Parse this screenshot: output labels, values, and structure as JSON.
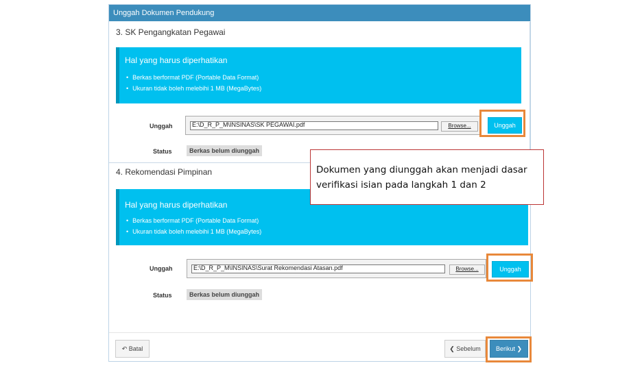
{
  "panel": {
    "title": "Unggah Dokumen Pendukung"
  },
  "sections": [
    {
      "title": "3. SK Pengangkatan Pegawai",
      "notice_title": "Hal yang harus diperhatikan",
      "notice_items": [
        "Berkas berformat PDF (Portable Data Format)",
        "Ukuran tidak boleh melebihi 1 MB (MegaBytes)"
      ],
      "upload_label": "Unggah",
      "file_path": "E:\\D_R_P_M\\INSINAS\\SK PEGAWAI.pdf",
      "browse_label": "Browse...",
      "upload_button": "Unggah",
      "status_label": "Status",
      "status_value": "Berkas belum diunggah"
    },
    {
      "title": "4. Rekomendasi Pimpinan",
      "notice_title": "Hal yang harus diperhatikan",
      "notice_items": [
        "Berkas berformat PDF (Portable Data Format)",
        "Ukuran tidak boleh melebihi 1 MB (MegaBytes)"
      ],
      "upload_label": "Unggah",
      "file_path": "E:\\D_R_P_M\\INSINAS\\Surat Rekomendasi Atasan.pdf",
      "browse_label": "Browse...",
      "upload_button": "Unggah",
      "status_label": "Status",
      "status_value": "Berkas belum diunggah"
    }
  ],
  "footer": {
    "back_label": "Batal",
    "back_icon": "undo-icon",
    "prev_label": "Sebelum",
    "prev_icon": "chevron-left-icon",
    "next_label": "Berikut",
    "next_icon": "chevron-right-icon"
  },
  "callout": {
    "text": "Dokumen yang diunggah akan menjadi dasar verifikasi isian pada langkah 1 dan 2"
  },
  "colors": {
    "header": "#3c8dbc",
    "notice": "#00c0ef",
    "highlight": "#e8883a"
  }
}
